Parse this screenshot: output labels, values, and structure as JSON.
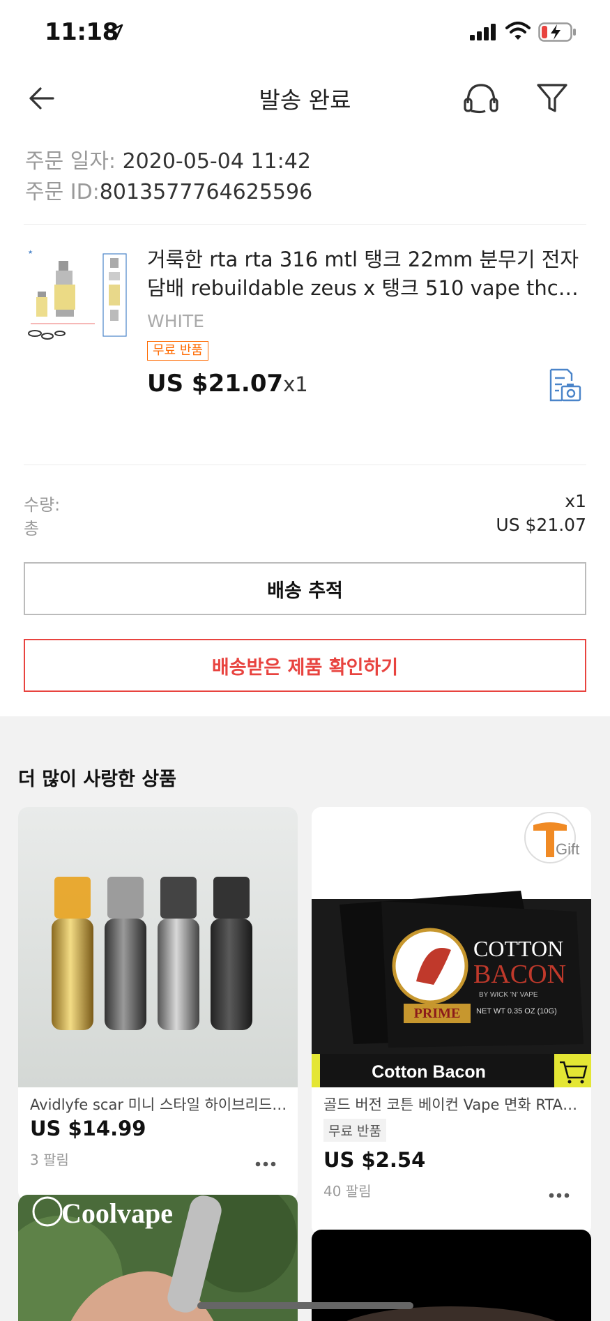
{
  "status_bar": {
    "time": "11:18"
  },
  "header": {
    "title": "발송 완료"
  },
  "order": {
    "date_label": "주문 일자:",
    "date_value": " 2020-05-04 11:42",
    "id_label": "주문 ID:",
    "id_value": "8013577764625596"
  },
  "product": {
    "title": "거룩한 rta rta 316 mtl 탱크 22mm 분무기 전자 담배 rebuildable zeus x 탱크 510 vape thc taur...",
    "variant": "WHITE",
    "tag": "무료 반품",
    "price": "US $21.07",
    "qty": "x1"
  },
  "summary": {
    "qty_label": "수량:",
    "qty_value": "x1",
    "total_label": "총",
    "total_value": "US $21.07"
  },
  "buttons": {
    "track": "배송 추적",
    "confirm": "배송받은 제품 확인하기"
  },
  "recommendations": {
    "heading": "더 많이 사랑한 상품",
    "items": [
      {
        "title": "Avidlyfe scar 미니 스타일 하이브리드 기계식 모드",
        "price": "US $14.99",
        "sold": "3 팔림"
      },
      {
        "title": "골드 버전 코튼 베이컨 Vape 면화 RTA RDA",
        "tag": "무료 반품",
        "price": "US $2.54",
        "sold": "40 팔림",
        "image_text": {
          "brand_line1": "COTTON",
          "brand_line2": "BACON",
          "by": "BY WICK 'N' VAPE",
          "badge": "PRIME",
          "net_wt": "NET WT 0.35 OZ (10G)",
          "banner": "Cotton Bacon",
          "gift": "Gift"
        }
      },
      {
        "image_text": "Coolvape"
      }
    ]
  },
  "colors": {
    "accent_red": "#e8433f",
    "orange_tag": "#ff6a00",
    "icon_blue": "#4a84c9"
  }
}
